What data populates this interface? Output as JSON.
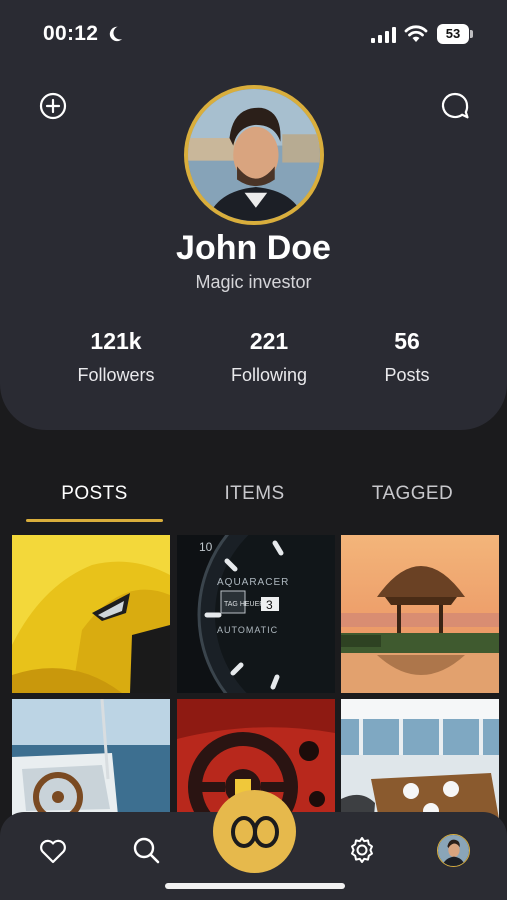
{
  "status_bar": {
    "time": "00:12",
    "battery": "53"
  },
  "profile": {
    "name": "John Doe",
    "subtitle": "Magic investor"
  },
  "stats": [
    {
      "value": "121k",
      "label": "Followers"
    },
    {
      "value": "221",
      "label": "Following"
    },
    {
      "value": "56",
      "label": "Posts"
    }
  ],
  "tabs": [
    {
      "label": "POSTS",
      "active": true
    },
    {
      "label": "ITEMS",
      "active": false
    },
    {
      "label": "TAGGED",
      "active": false
    }
  ],
  "grid_labels": {
    "watch_brand": "AQUARACER",
    "watch_logo": "TAG HEUER",
    "watch_type": "AUTOMATIC",
    "watch_date": "3",
    "watch_ten": "10"
  },
  "colors": {
    "accent": "#d9ae3c",
    "card": "#2a2b33",
    "background": "#1b1b1d",
    "fab": "#e6b94c"
  },
  "icons": {
    "top_left": "plus-circle-icon",
    "top_right": "chat-bubble-icon",
    "nav": [
      "heart-icon",
      "search-icon",
      "infinity-logo-icon",
      "gear-icon",
      "avatar"
    ]
  }
}
